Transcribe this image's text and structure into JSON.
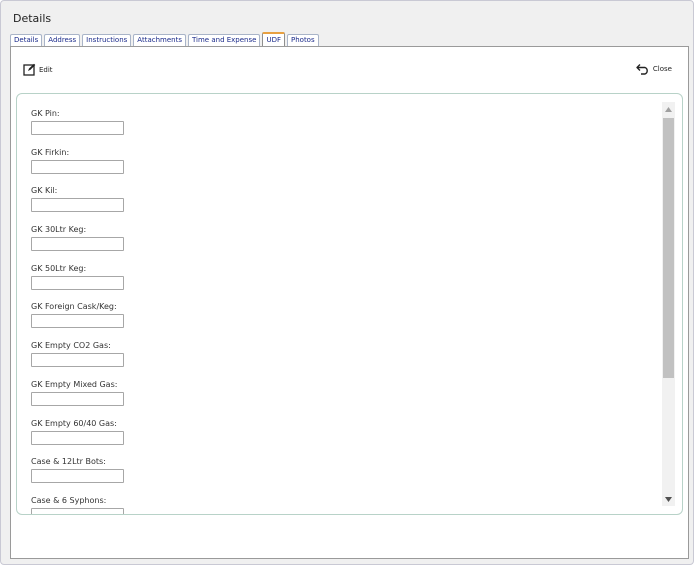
{
  "dialog": {
    "title": "Details"
  },
  "tabs": [
    {
      "label": "Details",
      "active": false
    },
    {
      "label": "Address",
      "active": false
    },
    {
      "label": "Instructions",
      "active": false
    },
    {
      "label": "Attachments",
      "active": false
    },
    {
      "label": "Time and Expense",
      "active": false
    },
    {
      "label": "UDF",
      "active": true
    },
    {
      "label": "Photos",
      "active": false
    }
  ],
  "toolbar": {
    "edit_label": "Edit",
    "close_label": "Close"
  },
  "fields": [
    {
      "label": "GK Pin:",
      "value": ""
    },
    {
      "label": "GK Firkin:",
      "value": ""
    },
    {
      "label": "GK Kil:",
      "value": ""
    },
    {
      "label": "GK 30Ltr Keg:",
      "value": ""
    },
    {
      "label": "GK 50Ltr Keg:",
      "value": ""
    },
    {
      "label": "GK Foreign Cask/Keg:",
      "value": ""
    },
    {
      "label": "GK Empty CO2 Gas:",
      "value": ""
    },
    {
      "label": "GK Empty Mixed Gas:",
      "value": ""
    },
    {
      "label": "GK Empty 60/40 Gas:",
      "value": ""
    },
    {
      "label": "Case & 12Ltr Bots:",
      "value": ""
    },
    {
      "label": "Case & 6 Syphons:",
      "value": ""
    }
  ],
  "icons": {
    "edit": "edit-icon",
    "close": "undo-arrow-icon",
    "scroll_up": "triangle-up-icon",
    "scroll_down": "triangle-down-icon"
  },
  "colors": {
    "active_tab_accent": "#e8a040",
    "tab_text": "#1a2a8a",
    "form_border": "#b8d2c8"
  }
}
